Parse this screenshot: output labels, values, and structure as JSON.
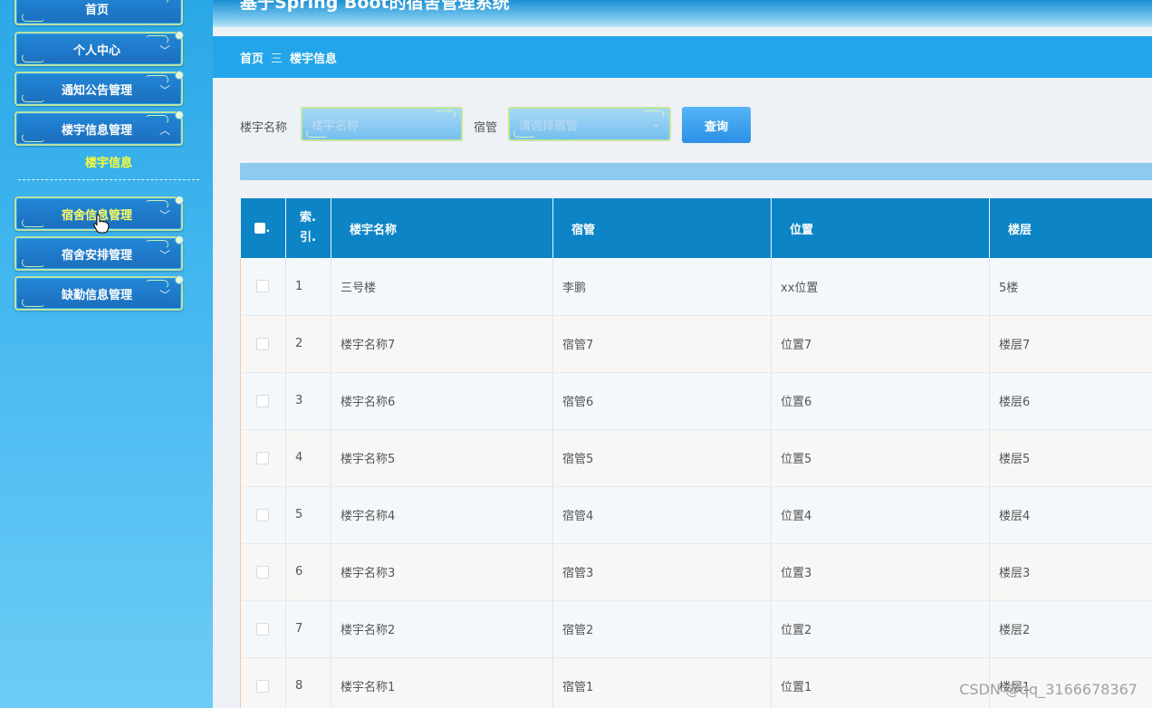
{
  "app": {
    "title": "基于Spring Boot的宿舍管理系统"
  },
  "sidebar": {
    "items": [
      {
        "label": "首页",
        "has_chevron": false
      },
      {
        "label": "个人中心",
        "has_chevron": true
      },
      {
        "label": "通知公告管理",
        "has_chevron": true
      },
      {
        "label": "楼宇信息管理",
        "has_chevron": true,
        "expanded": true
      },
      {
        "label": "宿舍信息管理",
        "has_chevron": true,
        "active": true
      },
      {
        "label": "宿舍安排管理",
        "has_chevron": true
      },
      {
        "label": "缺勤信息管理",
        "has_chevron": true
      }
    ],
    "submenu": {
      "label": "楼宇信息"
    }
  },
  "breadcrumb": {
    "home": "首页",
    "separator": "三",
    "current": "楼宇信息"
  },
  "search": {
    "name_label": "楼宇名称",
    "name_placeholder": "楼宇名称",
    "manager_label": "宿管",
    "manager_placeholder": "请选择宿管",
    "query_button": "查询"
  },
  "table": {
    "headers": {
      "select": ".",
      "index": "索.引.",
      "name": "楼宇名称",
      "manager": "宿管",
      "location": "位置",
      "floor": "楼层"
    },
    "rows": [
      {
        "index": "1",
        "name": "三号楼",
        "manager": "李鹏",
        "location": "xx位置",
        "floor": "5楼"
      },
      {
        "index": "2",
        "name": "楼宇名称7",
        "manager": "宿管7",
        "location": "位置7",
        "floor": "楼层7"
      },
      {
        "index": "3",
        "name": "楼宇名称6",
        "manager": "宿管6",
        "location": "位置6",
        "floor": "楼层6"
      },
      {
        "index": "4",
        "name": "楼宇名称5",
        "manager": "宿管5",
        "location": "位置5",
        "floor": "楼层5"
      },
      {
        "index": "5",
        "name": "楼宇名称4",
        "manager": "宿管4",
        "location": "位置4",
        "floor": "楼层4"
      },
      {
        "index": "6",
        "name": "楼宇名称3",
        "manager": "宿管3",
        "location": "位置3",
        "floor": "楼层3"
      },
      {
        "index": "7",
        "name": "楼宇名称2",
        "manager": "宿管2",
        "location": "位置2",
        "floor": "楼层2"
      },
      {
        "index": "8",
        "name": "楼宇名称1",
        "manager": "宿管1",
        "location": "位置1",
        "floor": "楼层1"
      }
    ]
  },
  "watermark": "CSDN @qq_3166678367",
  "colors": {
    "sidebar": "#2aa8e6",
    "header": "#0d84c6",
    "breadcrumb_bar": "#22a6e9",
    "active_text": "#ffff33"
  }
}
